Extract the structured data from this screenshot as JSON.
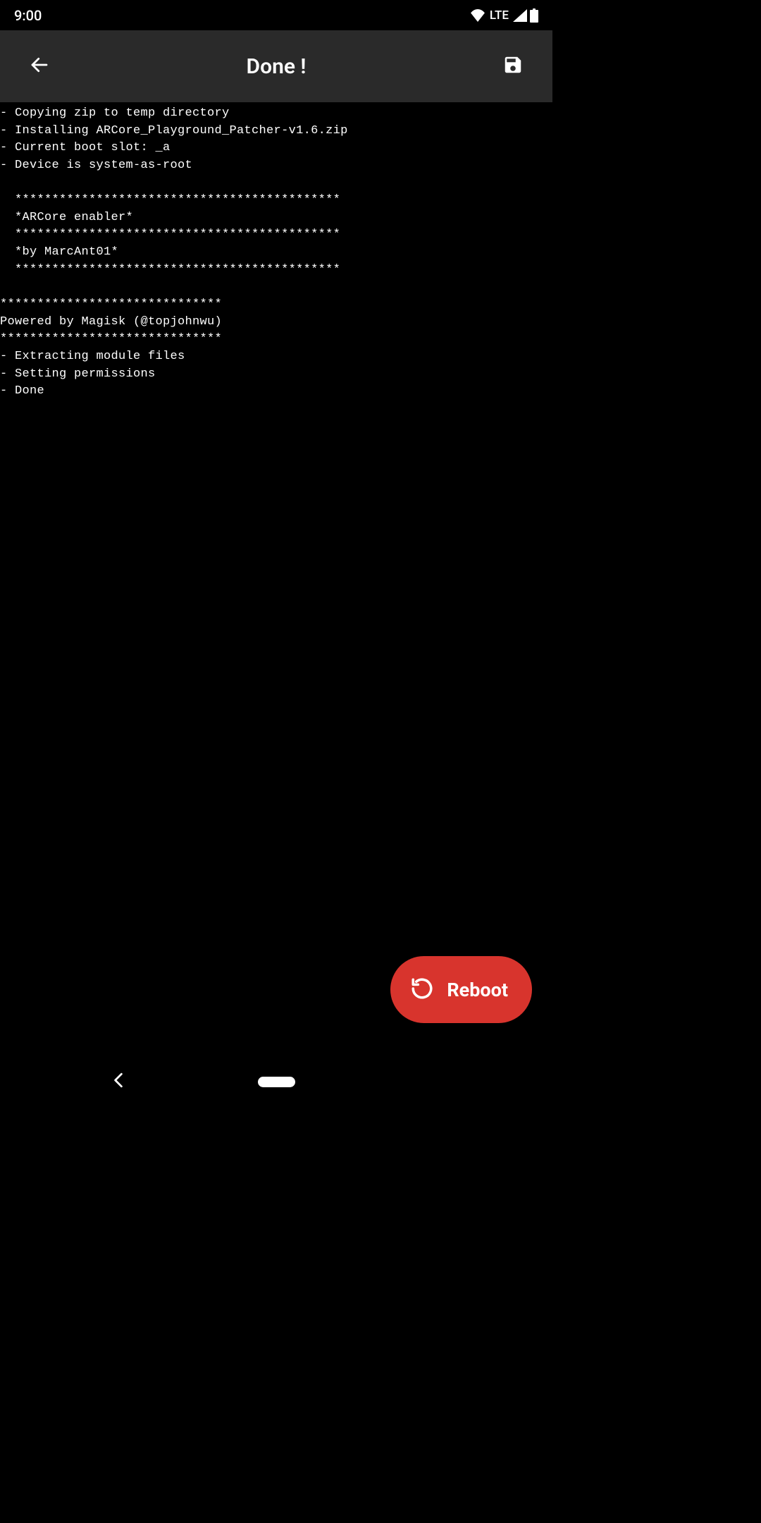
{
  "status_bar": {
    "time": "9:00",
    "network": "LTE"
  },
  "app_bar": {
    "title": "Done !"
  },
  "log": {
    "text": "- Copying zip to temp directory\n- Installing ARCore_Playground_Patcher-v1.6.zip\n- Current boot slot: _a\n- Device is system-as-root\n\n  ********************************************\n  *ARCore enabler*\n  ********************************************\n  *by MarcAnt01*\n  ********************************************\n\n******************************\nPowered by Magisk (@topjohnwu)\n******************************\n- Extracting module files\n- Setting permissions\n- Done"
  },
  "fab": {
    "label": "Reboot"
  },
  "colors": {
    "accent": "#d8342d",
    "bar_bg": "#2a2a2a"
  }
}
